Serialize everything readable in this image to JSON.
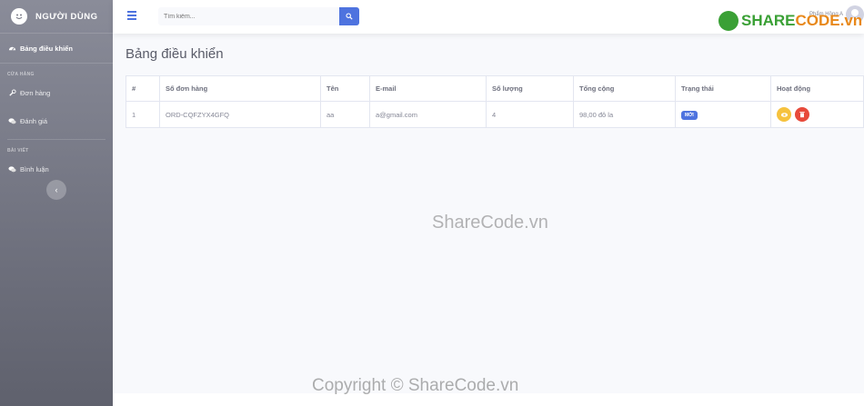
{
  "sidebar": {
    "brand": "NGƯỜI DÙNG",
    "dashboard": "Bảng điều khiển",
    "section_store": "CỬA HÀNG",
    "orders": "Đơn hàng",
    "reviews": "Đánh giá",
    "section_posts": "BÀI VIẾT",
    "comments": "Bình luận",
    "toggle": "‹"
  },
  "topbar": {
    "search_placeholder": "Tìm kiếm...",
    "user_name": "Phẩm Hồng A"
  },
  "watermark": {
    "logo_part1": "SHARE",
    "logo_part2": "CODE.vn",
    "center": "ShareCode.vn",
    "bottom": "Copyright © ShareCode.vn"
  },
  "page": {
    "title": "Bảng điều khiển"
  },
  "table": {
    "headers": [
      "#",
      "Số đơn hàng",
      "Tên",
      "E-mail",
      "Số lượng",
      "Tổng cộng",
      "Trạng thái",
      "Hoạt động"
    ],
    "rows": [
      {
        "index": "1",
        "order_no": "ORD-CQFZYX4GFQ",
        "name": "aa",
        "email": "a@gmail.com",
        "quantity": "4",
        "total": "98,00 đô la",
        "status": "MỚI"
      }
    ]
  },
  "colors": {
    "primary": "#4e73df",
    "warning": "#f6c23e",
    "danger": "#e74a3b"
  }
}
